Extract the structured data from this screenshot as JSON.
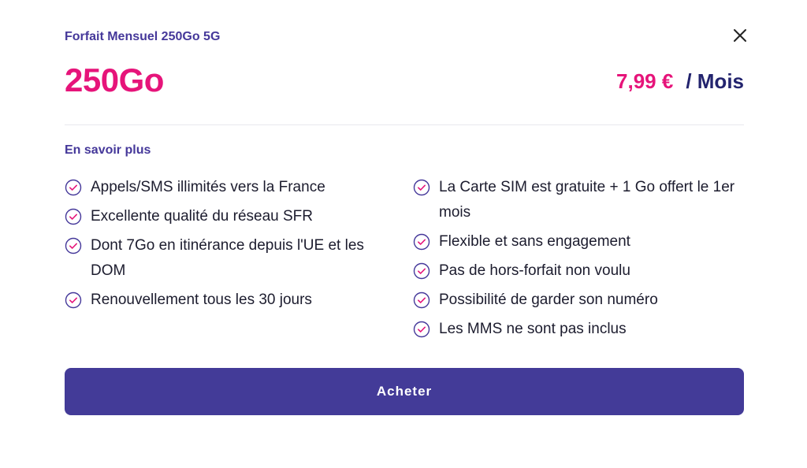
{
  "header": {
    "plan_name": "Forfait Mensuel 250Go 5G",
    "close_icon": "close-icon"
  },
  "offer": {
    "data_amount": "250Go",
    "price": "7,99 €",
    "period": "/ Mois"
  },
  "details": {
    "more_label": "En savoir plus",
    "features_left": [
      "Appels/SMS illimités vers la France",
      "Excellente qualité du réseau SFR",
      "Dont 7Go en itinérance depuis l'UE et les DOM",
      "Renouvellement tous les 30 jours"
    ],
    "features_right": [
      "La Carte SIM est gratuite + 1 Go offert le 1er mois",
      "Flexible et sans engagement",
      "Pas de hors-forfait non voulu",
      "Possibilité de garder son numéro",
      "Les MMS ne sont pas inclus"
    ],
    "check_icon": "check-circle-icon"
  },
  "actions": {
    "buy_label": "Acheter"
  },
  "colors": {
    "accent_pink": "#e6147a",
    "brand_purple": "#433b98",
    "check_circle": "#45389a",
    "check_mark": "#e6147a"
  }
}
